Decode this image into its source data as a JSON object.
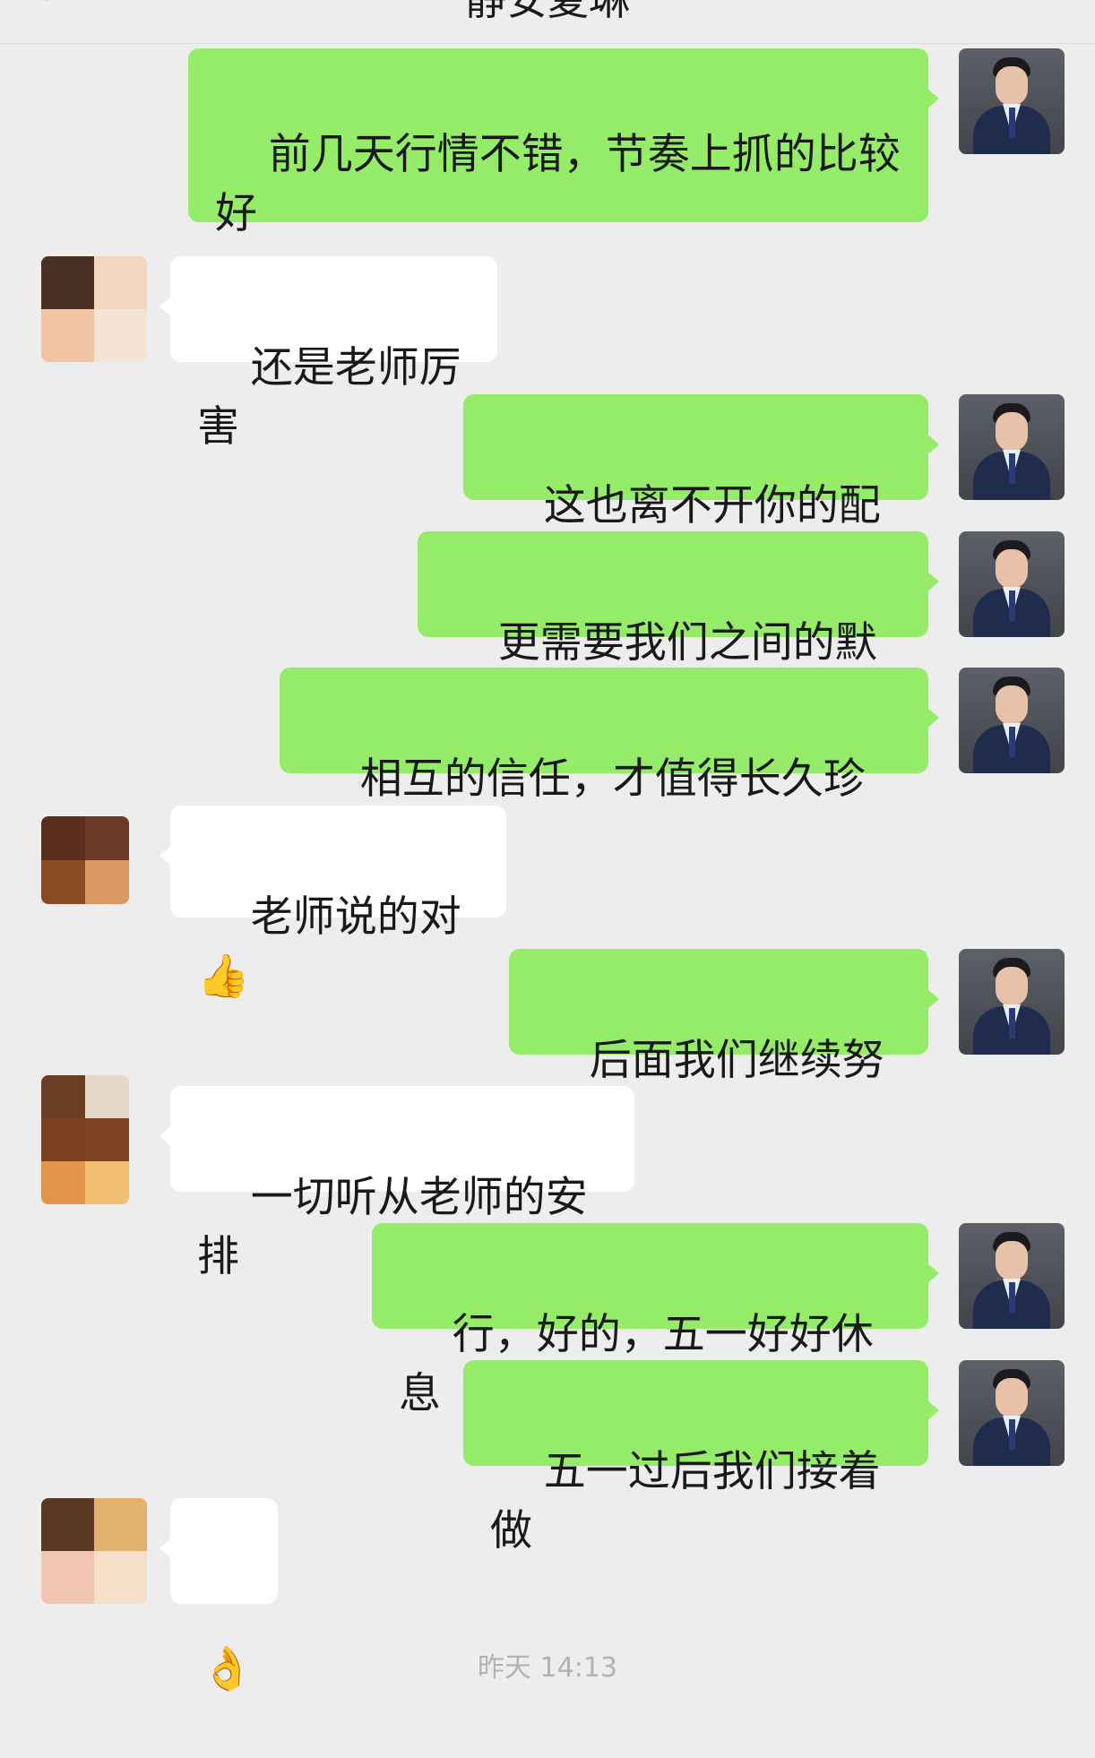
{
  "header": {
    "title": "静安夏琳",
    "back_icon": "chevron-left-icon"
  },
  "messages": [
    {
      "side": "self",
      "text": "前几天行情不错，节奏上抓的比较好"
    },
    {
      "side": "peer",
      "text": "还是老师厉害"
    },
    {
      "side": "self",
      "text": "这也离不开你的配合"
    },
    {
      "side": "self",
      "text": "更需要我们之间的默契"
    },
    {
      "side": "self",
      "text": "相互的信任，才值得长久珍惜"
    },
    {
      "side": "peer",
      "text": "老师说的对👍"
    },
    {
      "side": "self",
      "text": "后面我们继续努力"
    },
    {
      "side": "peer",
      "text": "一切听从老师的安排"
    },
    {
      "side": "self",
      "text": "行，好的，五一好好休息"
    },
    {
      "side": "self",
      "text": "五一过后我们接着做"
    },
    {
      "side": "peer",
      "text": "👌"
    }
  ],
  "time_divider": "昨天 14:13",
  "colors": {
    "background": "#ededed",
    "self_bubble": "#95ec69",
    "peer_bubble": "#ffffff"
  }
}
